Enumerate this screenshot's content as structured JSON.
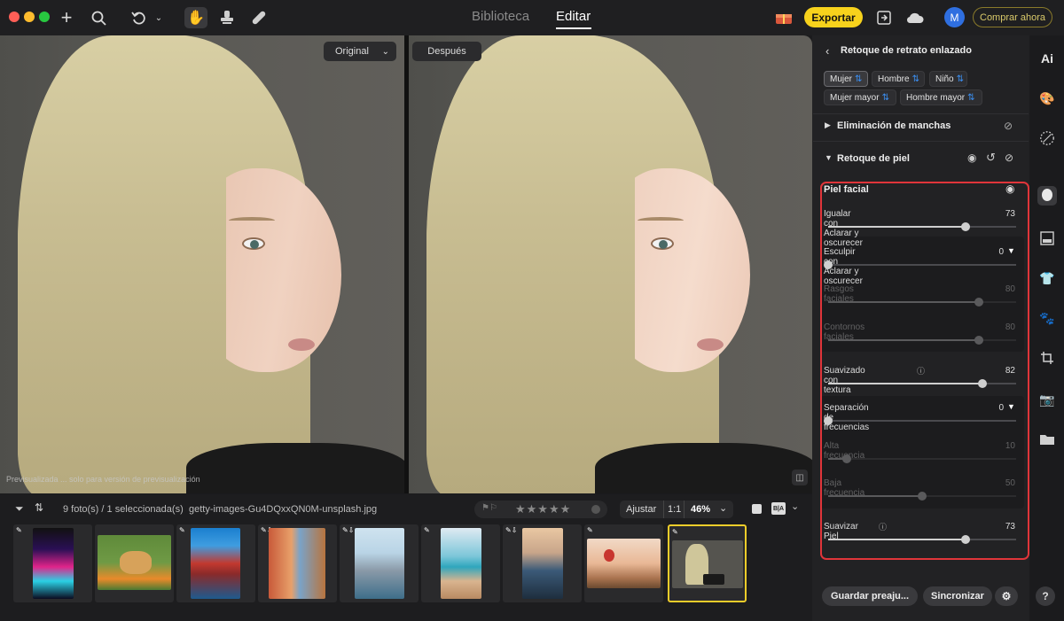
{
  "titlebar": {
    "tabs": [
      "Biblioteca",
      "Editar"
    ],
    "active_tab": "Editar",
    "export_label": "Exportar",
    "buy_label": "Comprar ahora",
    "avatar_initial": "M"
  },
  "canvas": {
    "before_select": "Original",
    "after_label": "Después",
    "preview_note": "Previsualizada ... solo para versión de previsualización"
  },
  "filmstrip": {
    "count_text": "9 foto(s) / 1 seleccionada(s)",
    "filename": "getty-images-Gu4DQxxQN0M-unsplash.jpg",
    "fit_label": "Ajustar",
    "one_to_one": "1:1",
    "zoom": "46%",
    "ba_label": "B|A",
    "rating_stars": 5
  },
  "panel": {
    "title": "Retoque de retrato enlazado",
    "chips": [
      {
        "label": "Mujer",
        "active": true
      },
      {
        "label": "Hombre",
        "active": false
      },
      {
        "label": "Niño",
        "active": false
      },
      {
        "label": "Mujer mayor",
        "active": false
      },
      {
        "label": "Hombre mayor",
        "active": false
      }
    ],
    "section_blemish": "Eliminación de manchas",
    "section_skin": "Retoque de piel",
    "group_title": "Piel facial",
    "sliders": [
      {
        "label": "Igualar con Aclarar y oscurecer",
        "value": 73,
        "max": 100,
        "dim": false
      },
      {
        "label": "Esculpir con Aclarar y oscurecer",
        "value": 0,
        "max": 100,
        "dim": false,
        "dropdown": true
      },
      {
        "label": "Rasgos faciales",
        "value": 80,
        "max": 100,
        "dim": true
      },
      {
        "label": "Contornos faciales",
        "value": 80,
        "max": 100,
        "dim": true
      },
      {
        "label": "Suavizado con textura",
        "value": 82,
        "max": 100,
        "dim": false,
        "info": true
      },
      {
        "label": "Separación de frecuencias",
        "value": 0,
        "max": 100,
        "dim": false,
        "dropdown": true
      },
      {
        "label": "Alta frecuencia",
        "value": 10,
        "max": 100,
        "dim": true
      },
      {
        "label": "Baja frecuencia",
        "value": 50,
        "max": 100,
        "dim": true
      },
      {
        "label": "Suavizar Piel",
        "value": 73,
        "max": 100,
        "dim": false,
        "info": true
      }
    ],
    "save_preset": "Guardar preaju...",
    "sync": "Sincronizar"
  },
  "rail": {
    "ai_label": "Ai",
    "help": "?"
  },
  "colors": {
    "accent_yellow": "#f7d21c",
    "highlight_red": "#e0353a",
    "selection": "#f0cd2a"
  }
}
